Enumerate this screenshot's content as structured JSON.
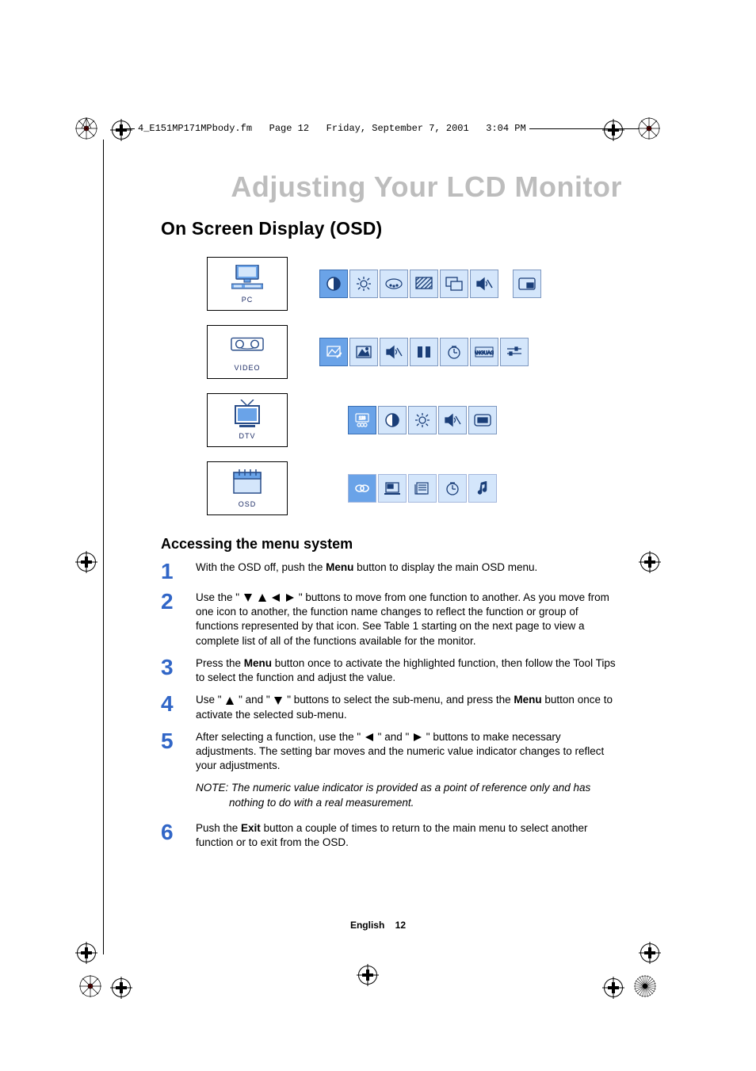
{
  "tagline": "4_E151MP171MPbody.fm   Page 12   Friday, September 7, 2001   3:04 PM",
  "chapter_title": "Adjusting Your LCD Monitor",
  "section_title": "On Screen Display (OSD)",
  "osd_groups": [
    {
      "label": "PC",
      "row_role": "pc"
    },
    {
      "label": "VIDEO",
      "row_role": "video"
    },
    {
      "label": "DTV",
      "row_role": "dtv"
    },
    {
      "label": "OSD",
      "row_role": "osd"
    }
  ],
  "sub_title": "Accessing the menu system",
  "steps": [
    {
      "n": "1",
      "html": "With the OSD off, push the <b>Menu</b> button to display the main OSD menu."
    },
    {
      "n": "2",
      "html": "Use the \" <svg class='arrow' viewBox='0 0 10 10'><polygon points='5,10 0,0 10,0'/></svg> <svg class='arrow' viewBox='0 0 10 10'><polygon points='5,0 10,10 0,10'/></svg> <svg class='arrow' viewBox='0 0 10 10'><polygon points='0,5 10,0 10,10'/></svg> <svg class='arrow' viewBox='0 0 10 10'><polygon points='10,5 0,0 0,10'/></svg> \" buttons to move from one function to another. As you move from one icon to another, the function name changes to reflect the function or group of functions represented by that icon. See Table 1 starting on the next page to view a complete list of all of the functions available for the monitor."
    },
    {
      "n": "3",
      "html": "Press the <b>Menu</b> button once to activate the highlighted function, then follow the Tool Tips to select the function and adjust the value."
    },
    {
      "n": "4",
      "html": "Use \" <svg class='arrow' viewBox='0 0 10 10'><polygon points='5,0 10,10 0,10'/></svg> \" and \" <svg class='arrow' viewBox='0 0 10 10'><polygon points='5,10 0,0 10,0'/></svg> \" buttons to select the sub-menu,  and press the <b>Menu</b> button once to activate the selected sub-menu."
    },
    {
      "n": "5",
      "html": "After selecting a function, use the \" <svg class='arrow' viewBox='0 0 10 10'><polygon points='0,5 10,0 10,10'/></svg> \" and \" <svg class='arrow' viewBox='0 0 10 10'><polygon points='10,5 0,0 0,10'/></svg> \" buttons to make necessary adjustments. The setting bar moves and the numeric value indicator changes to reflect your adjustments."
    },
    {
      "n": "6",
      "html": "Push the  <b>Exit</b> button a couple of times to return to the main menu to select another function or to exit from the OSD."
    }
  ],
  "note_lead": "NOTE: The numeric value indicator is provided as a point of reference only and has",
  "note_rest": "nothing to do with a real measurement.",
  "footer_lang": "English",
  "footer_page": "12"
}
